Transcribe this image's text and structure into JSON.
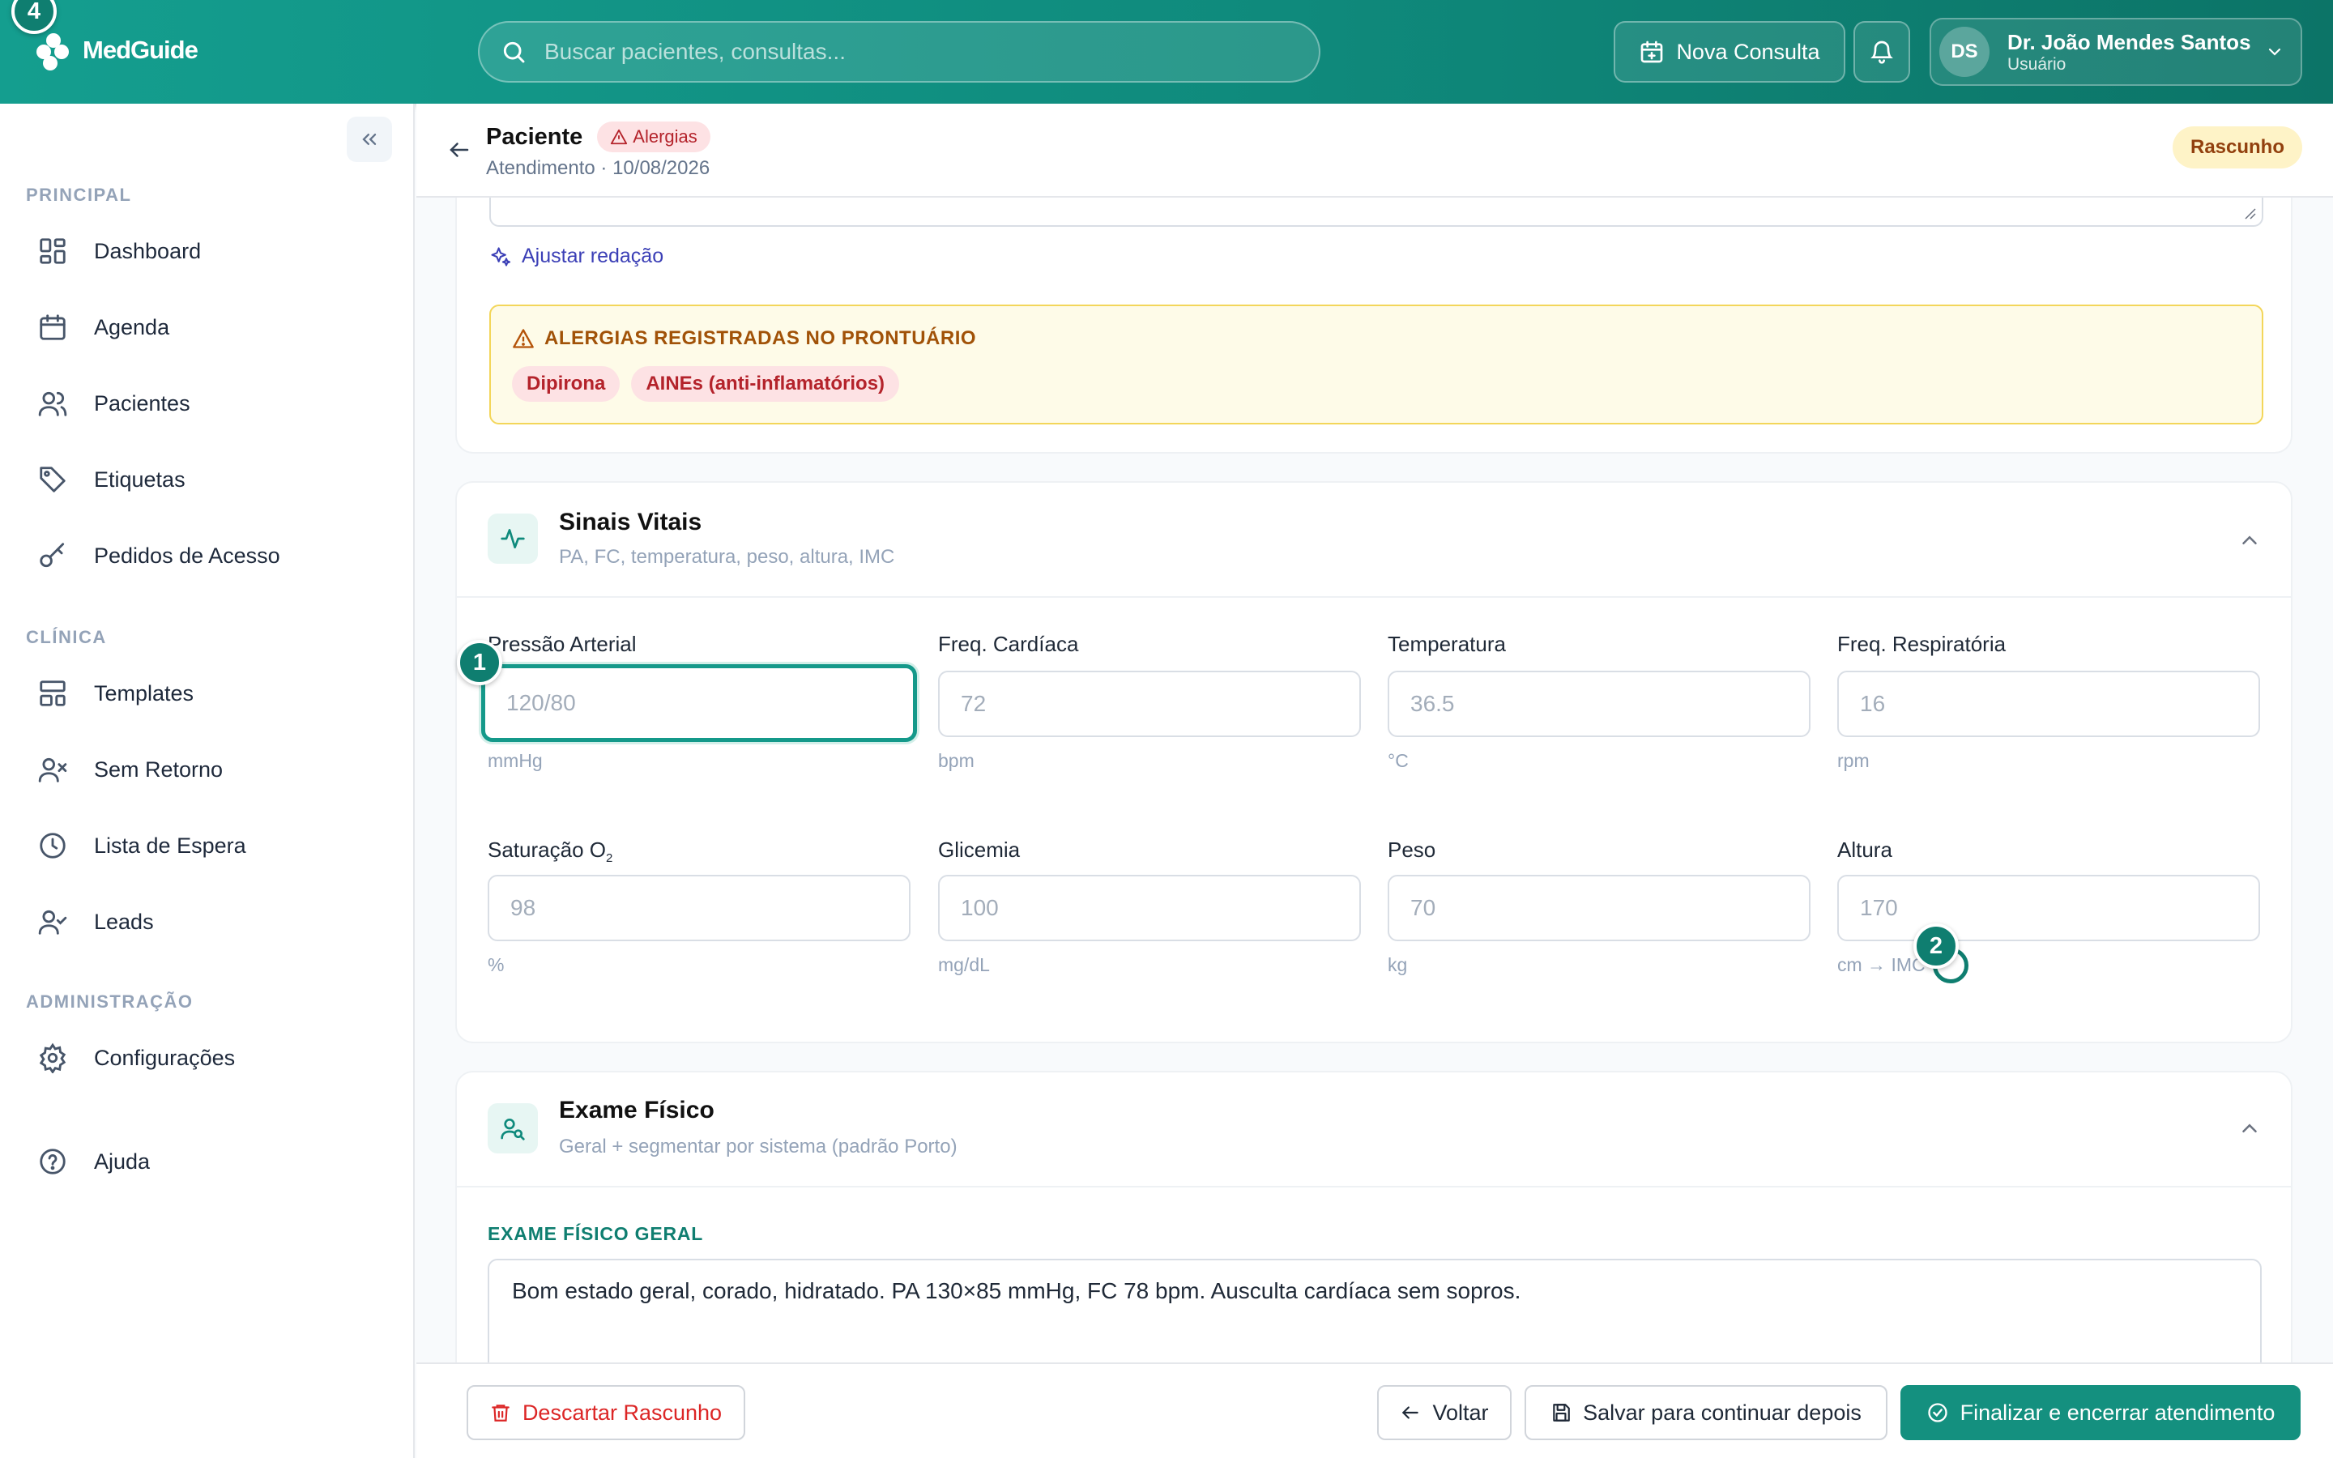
{
  "header": {
    "brand": "MedGuide",
    "search_placeholder": "Buscar pacientes, consultas...",
    "new_consult_label": "Nova Consulta",
    "user_initials": "DS",
    "user_name": "Dr. João Mendes Santos",
    "user_role": "Usuário",
    "colors": {
      "primary": "#149e8f",
      "primary_dark": "#0c7467"
    }
  },
  "markers": [
    "4",
    "1",
    "2"
  ],
  "sidebar": {
    "sections": [
      {
        "title": "PRINCIPAL",
        "items": [
          {
            "label": "Dashboard",
            "icon": "grid-icon"
          },
          {
            "label": "Agenda",
            "icon": "calendar-icon"
          },
          {
            "label": "Pacientes",
            "icon": "users-icon"
          },
          {
            "label": "Etiquetas",
            "icon": "tag-icon"
          },
          {
            "label": "Pedidos de Acesso",
            "icon": "key-icon"
          }
        ]
      },
      {
        "title": "CLÍNICA",
        "items": [
          {
            "label": "Templates",
            "icon": "layout-icon"
          },
          {
            "label": "Sem Retorno",
            "icon": "user-x-icon"
          },
          {
            "label": "Lista de Espera",
            "icon": "clock-icon"
          },
          {
            "label": "Leads",
            "icon": "user-check-icon"
          }
        ]
      },
      {
        "title": "ADMINISTRAÇÃO",
        "items": [
          {
            "label": "Configurações",
            "icon": "gear-icon"
          }
        ]
      }
    ],
    "help_label": "Ajuda"
  },
  "page": {
    "title": "Paciente",
    "allergy_badge": "Alergias",
    "subtitle": "Atendimento · 10/08/2026",
    "status_badge": "Rascunho"
  },
  "assist": {
    "adjust_label": "Ajustar redação"
  },
  "allergies": {
    "title": "ALERGIAS REGISTRADAS NO PRONTUÁRIO",
    "items": [
      "Dipirona",
      "AINEs (anti-inflamatórios)"
    ]
  },
  "vitals": {
    "title": "Sinais Vitais",
    "subtitle": "PA, FC, temperatura, peso, altura, IMC",
    "fields": [
      {
        "label": "Pressão Arterial",
        "placeholder": "120/80",
        "unit": "mmHg"
      },
      {
        "label": "Freq. Cardíaca",
        "placeholder": "72",
        "unit": "bpm"
      },
      {
        "label": "Temperatura",
        "placeholder": "36.5",
        "unit": "°C"
      },
      {
        "label": "Freq. Respiratória",
        "placeholder": "16",
        "unit": "rpm"
      },
      {
        "label": "Saturação O",
        "label_sub": "2",
        "placeholder": "98",
        "unit": "%"
      },
      {
        "label": "Glicemia",
        "placeholder": "100",
        "unit": "mg/dL"
      },
      {
        "label": "Peso",
        "placeholder": "70",
        "unit": "kg"
      },
      {
        "label": "Altura",
        "placeholder": "170",
        "unit": "cm → IMC -"
      }
    ]
  },
  "exam": {
    "title": "Exame Físico",
    "subtitle": "Geral + segmentar por sistema (padrão Porto)",
    "general_label": "EXAME FÍSICO GERAL",
    "general_text": "Bom estado geral, corado, hidratado. PA 130×85 mmHg, FC 78 bpm. Ausculta cardíaca sem sopros."
  },
  "footer": {
    "discard_label": "Descartar Rascunho",
    "back_label": "Voltar",
    "save_label": "Salvar para continuar depois",
    "finish_label": "Finalizar e encerrar atendimento"
  }
}
